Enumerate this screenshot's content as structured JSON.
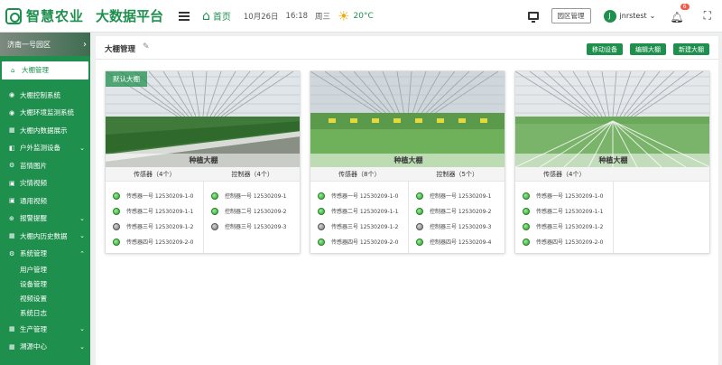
{
  "brand": {
    "name": "智慧农业",
    "platform": "大数据平台"
  },
  "topbar": {
    "home": "首页",
    "date": "10月26日",
    "time": "16:18",
    "weekday": "周三",
    "temp": "20°C",
    "park_btn": "园区管理",
    "avatar": "J",
    "user": "jnrstest",
    "notifications": "6"
  },
  "sidebar": {
    "park": "济南一号园区",
    "active": "大棚管理",
    "items": [
      {
        "icon": "◉",
        "label": "大棚控制系统",
        "caret": ""
      },
      {
        "icon": "◉",
        "label": "大棚环境监测系统",
        "caret": ""
      },
      {
        "icon": "▦",
        "label": "大棚内数据展示",
        "caret": ""
      },
      {
        "icon": "◧",
        "label": "户外监测设备",
        "caret": "⌄"
      },
      {
        "icon": "⚙",
        "label": "苗情图片",
        "caret": ""
      },
      {
        "icon": "▣",
        "label": "灾情视频",
        "caret": ""
      },
      {
        "icon": "▣",
        "label": "通用视频",
        "caret": ""
      },
      {
        "icon": "⊕",
        "label": "报警提醒",
        "caret": "⌄"
      },
      {
        "icon": "▦",
        "label": "大棚内历史数据",
        "caret": "⌄"
      },
      {
        "icon": "⚙",
        "label": "系统管理",
        "caret": "⌃"
      }
    ],
    "subitems": [
      "用户管理",
      "设备管理",
      "视频设置",
      "系统日志"
    ],
    "items2": [
      {
        "icon": "▦",
        "label": "生产管理",
        "caret": "⌄"
      },
      {
        "icon": "▦",
        "label": "溯源中心",
        "caret": "⌄"
      }
    ]
  },
  "panel": {
    "title": "大棚管理",
    "buttons": [
      "移动设备",
      "编辑大棚",
      "新建大棚"
    ]
  },
  "greenhouses": [
    {
      "name": "种植大棚",
      "tag": "默认大棚",
      "sensors_header": "传感器（4个）",
      "controllers_header": "控制器（4个）",
      "sensors": [
        {
          "label": "传感器一号 12530209-1-0",
          "on": true
        },
        {
          "label": "传感器二号 12530209-1-1",
          "on": true
        },
        {
          "label": "传感器三号 12530209-1-2",
          "on": false
        },
        {
          "label": "传感器四号 12530209-2-0",
          "on": true
        }
      ],
      "controllers": [
        {
          "label": "控制器一号 12530209-1",
          "on": true
        },
        {
          "label": "控制器二号 12530209-2",
          "on": true
        },
        {
          "label": "控制器三号 12530209-3",
          "on": false
        }
      ]
    },
    {
      "name": "种植大棚",
      "tag": "",
      "sensors_header": "传感器（8个）",
      "controllers_header": "控制器（5个）",
      "sensors": [
        {
          "label": "传感器一号 12530209-1-0",
          "on": true
        },
        {
          "label": "传感器二号 12530209-1-1",
          "on": true
        },
        {
          "label": "传感器三号 12530209-1-2",
          "on": false
        },
        {
          "label": "传感器四号 12530209-2-0",
          "on": true
        }
      ],
      "controllers": [
        {
          "label": "控制器一号 12530209-1",
          "on": true
        },
        {
          "label": "控制器二号 12530209-2",
          "on": true
        },
        {
          "label": "控制器三号 12530209-3",
          "on": false
        },
        {
          "label": "控制器四号 12530209-4",
          "on": true
        }
      ]
    },
    {
      "name": "种植大棚",
      "tag": "",
      "sensors_header": "传感器（4个）",
      "controllers_header": "",
      "sensors": [
        {
          "label": "传感器一号 12530209-1-0",
          "on": true
        },
        {
          "label": "传感器二号 12530209-1-1",
          "on": true
        },
        {
          "label": "传感器三号 12530209-1-2",
          "on": true
        },
        {
          "label": "传感器四号 12530209-2-0",
          "on": true
        }
      ],
      "controllers": []
    }
  ]
}
